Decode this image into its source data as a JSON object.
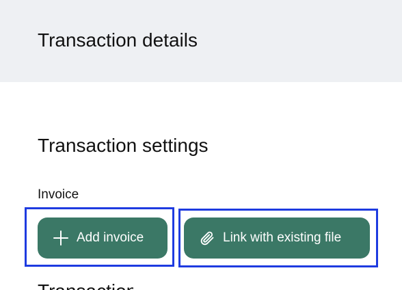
{
  "header": {
    "title": "Transaction details"
  },
  "settings": {
    "title": "Transaction settings",
    "invoice_label": "Invoice",
    "add_invoice_label": "Add invoice",
    "link_file_label": "Link with existing file",
    "next_section_partial": "Transaction"
  },
  "colors": {
    "header_bg": "#eef0f3",
    "button_bg": "#3b7866",
    "highlight_border": "#1e3be0"
  },
  "icons": {
    "add_invoice": "plus-icon",
    "link_file": "paperclip-icon"
  }
}
